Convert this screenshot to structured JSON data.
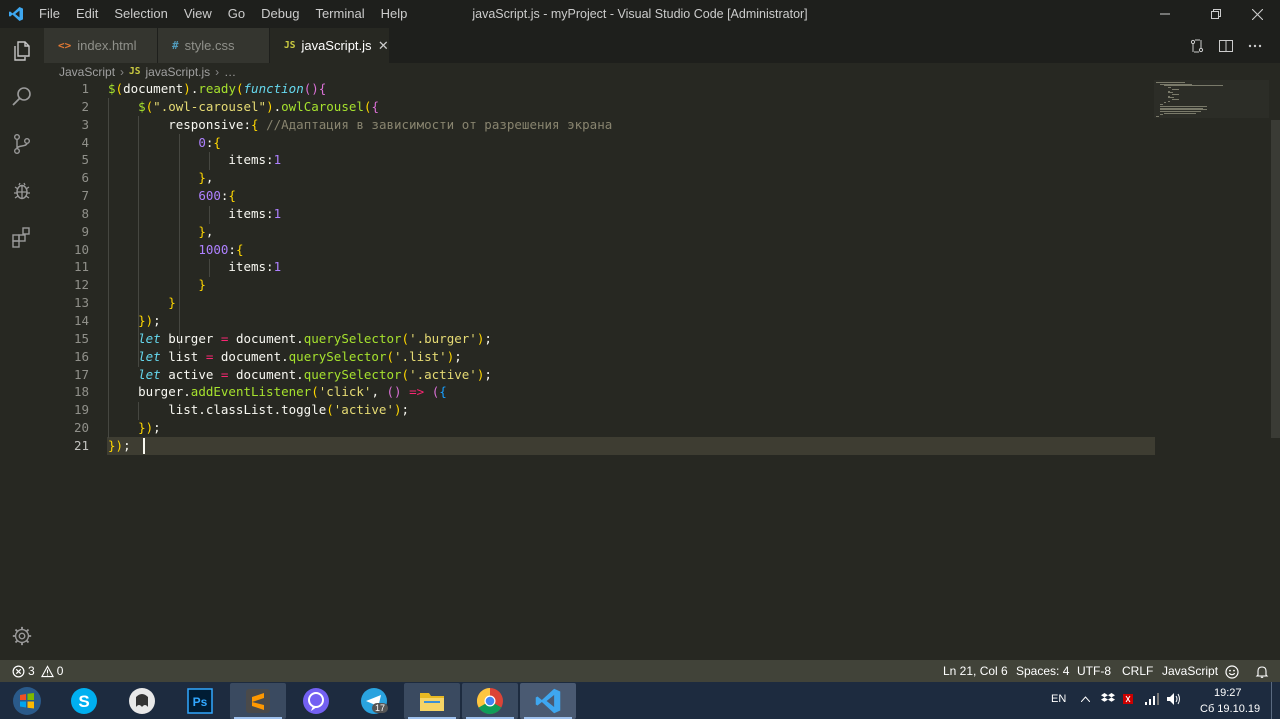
{
  "titlebar": {
    "app_icon": "vscode-logo-icon",
    "title": "javaScript.js - myProject - Visual Studio Code [Administrator]",
    "menu": [
      "File",
      "Edit",
      "Selection",
      "View",
      "Go",
      "Debug",
      "Terminal",
      "Help"
    ]
  },
  "activity_bar": [
    "explorer-icon",
    "search-icon",
    "source-control-icon",
    "debug-icon",
    "extensions-icon",
    "gear-icon"
  ],
  "tabs": [
    {
      "icon": "<>",
      "label": "index.html",
      "active": false,
      "icon_color": "#e37933"
    },
    {
      "icon": "#",
      "label": "style.css",
      "active": false,
      "icon_color": "#519aba"
    },
    {
      "icon": "JS",
      "label": "javaScript.js",
      "active": true,
      "icon_color": "#cbcb41",
      "close": "✕"
    }
  ],
  "breadcrumb": {
    "language": "JavaScript",
    "sep": "›",
    "file_badge": "JS",
    "file": "javaScript.js",
    "tail": "…"
  },
  "editor": {
    "line_numbers": [
      "1",
      "2",
      "3",
      "4",
      "5",
      "6",
      "7",
      "8",
      "9",
      "10",
      "11",
      "12",
      "13",
      "14",
      "15",
      "16",
      "17",
      "18",
      "19",
      "20",
      "21"
    ],
    "current_line": "21",
    "lines": [
      "$(document).ready(function(){",
      "    $(\".owl-carousel\").owlCarousel({",
      "        responsive:{ //Адаптация в зависимости от разрешения экрана",
      "            0:{",
      "                items:1",
      "            },",
      "            600:{",
      "                items:1",
      "            },",
      "            1000:{",
      "                items:1",
      "            }",
      "        }",
      "    });",
      "    let burger = document.querySelector('.burger');",
      "    let list = document.querySelector('.list');",
      "    let active = document.querySelector('.active');",
      "    burger.addEventListener('click', () => ({",
      "        list.classList.toggle('active');",
      "    });",
      "});"
    ]
  },
  "statusbar": {
    "problems_icon": "error-circle-icon",
    "errors": "3",
    "warnings_icon": "warning-icon",
    "warnings": "0",
    "position": "Ln 21, Col 6",
    "spaces": "Spaces: 4",
    "encoding": "UTF-8",
    "eol": "CRLF",
    "language": "JavaScript",
    "feedback_icon": "smiley-icon",
    "bell_icon": "bell-icon"
  },
  "taskbar": {
    "apps": [
      "windows-start-icon",
      "skype-icon",
      "bitnami-icon",
      "photoshop-icon",
      "sublime-text-icon",
      "viber-icon",
      "telegram-icon",
      "file-explorer-icon",
      "chrome-icon",
      "vscode-icon"
    ],
    "telegram_badge": "17",
    "photoshop_label": "Ps",
    "language": "EN",
    "time": "19:27",
    "date": "Сб 19.10.19"
  },
  "colors": {
    "background": "#272822",
    "titlebar": "#1e1f1c",
    "statusbar": "#414339",
    "taskbar": "#1d2b3f"
  }
}
